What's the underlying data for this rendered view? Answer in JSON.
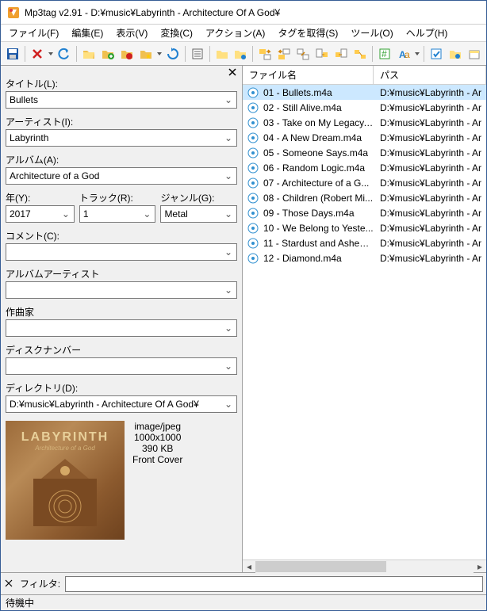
{
  "window": {
    "title": "Mp3tag v2.91  -  D:¥music¥Labyrinth - Architecture Of A God¥"
  },
  "menu": {
    "file": "ファイル(F)",
    "edit": "編集(E)",
    "view": "表示(V)",
    "convert": "変換(C)",
    "actions": "アクション(A)",
    "tagsources": "タグを取得(S)",
    "tools": "ツール(O)",
    "help": "ヘルプ(H)"
  },
  "tags": {
    "title_label": "タイトル(L):",
    "title_value": "Bullets",
    "artist_label": "アーティスト(I):",
    "artist_value": "Labyrinth",
    "album_label": "アルバム(A):",
    "album_value": "Architecture of a God",
    "year_label": "年(Y):",
    "year_value": "2017",
    "track_label": "トラック(R):",
    "track_value": "1",
    "genre_label": "ジャンル(G):",
    "genre_value": "Metal",
    "comment_label": "コメント(C):",
    "comment_value": "",
    "albumartist_label": "アルバムアーティスト",
    "albumartist_value": "",
    "composer_label": "作曲家",
    "composer_value": "",
    "discno_label": "ディスクナンバー",
    "discno_value": "",
    "directory_label": "ディレクトリ(D):",
    "directory_value": "D:¥music¥Labyrinth - Architecture Of A God¥"
  },
  "cover": {
    "logo": "LABYRINTH",
    "subtitle": "Architecture of a God",
    "mime": "image/jpeg",
    "dims": "1000x1000",
    "size": "390 KB",
    "type": "Front Cover"
  },
  "filelist": {
    "col_filename": "ファイル名",
    "col_path": "パス",
    "rows": [
      {
        "fn": "01 - Bullets.m4a",
        "selected": true
      },
      {
        "fn": "02 - Still Alive.m4a",
        "selected": false
      },
      {
        "fn": "03 - Take on My Legacy....",
        "selected": false
      },
      {
        "fn": "04 - A New Dream.m4a",
        "selected": false
      },
      {
        "fn": "05 - Someone Says.m4a",
        "selected": false
      },
      {
        "fn": "06 - Random Logic.m4a",
        "selected": false
      },
      {
        "fn": "07 - Architecture of a G...",
        "selected": false
      },
      {
        "fn": "08 - Children (Robert Mi...",
        "selected": false
      },
      {
        "fn": "09 - Those Days.m4a",
        "selected": false
      },
      {
        "fn": "10 - We Belong to Yeste...",
        "selected": false
      },
      {
        "fn": "11 - Stardust and Ashes....",
        "selected": false
      },
      {
        "fn": "12 - Diamond.m4a",
        "selected": false
      }
    ],
    "path_text": "D:¥music¥Labyrinth - Ar"
  },
  "filter": {
    "label": "フィルタ:",
    "value": ""
  },
  "status": {
    "text": "待機中"
  }
}
